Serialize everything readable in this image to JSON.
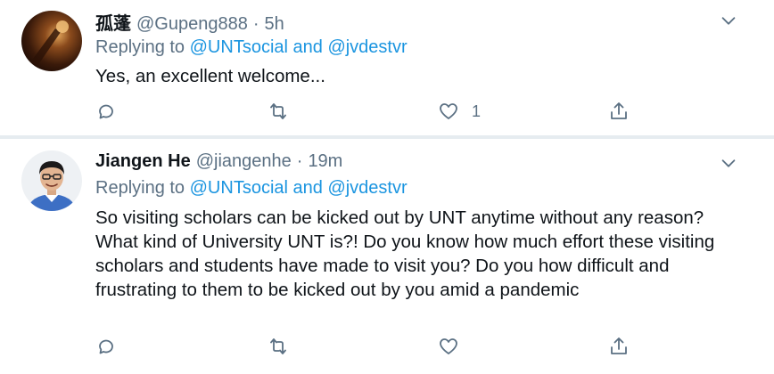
{
  "tweets": [
    {
      "display_name": "孤蓬",
      "handle": "@Gupeng888",
      "separator": "·",
      "time": "5h",
      "replying_prefix": "Replying to ",
      "mention_1": "@UNTsocial",
      "replying_and": " and ",
      "mention_2": "@jvdestvr",
      "text": "Yes, an excellent welcome...",
      "actions": {
        "reply_count": "",
        "retweet_count": "",
        "like_count": "1"
      }
    },
    {
      "display_name": "Jiangen He",
      "handle": "@jiangenhe",
      "separator": "·",
      "time": "19m",
      "replying_prefix": "Replying to ",
      "mention_1": "@UNTsocial",
      "replying_and": " and ",
      "mention_2": "@jvdestvr",
      "text": "So visiting scholars can be kicked out by UNT anytime without any reason? What kind of University UNT is?! Do you know how much effort these visiting scholars and students have made to visit you? Do you how difficult and frustrating to them to be kicked out by you amid a pandemic",
      "actions": {
        "reply_count": "",
        "retweet_count": "",
        "like_count": ""
      }
    }
  ],
  "icons": {
    "caret": "chevron-down-icon",
    "reply": "reply-icon",
    "retweet": "retweet-icon",
    "like": "heart-icon",
    "share": "share-icon"
  },
  "colors": {
    "link": "#1b95e0",
    "secondary_text": "#5b7083",
    "divider": "#e6ecf0"
  }
}
